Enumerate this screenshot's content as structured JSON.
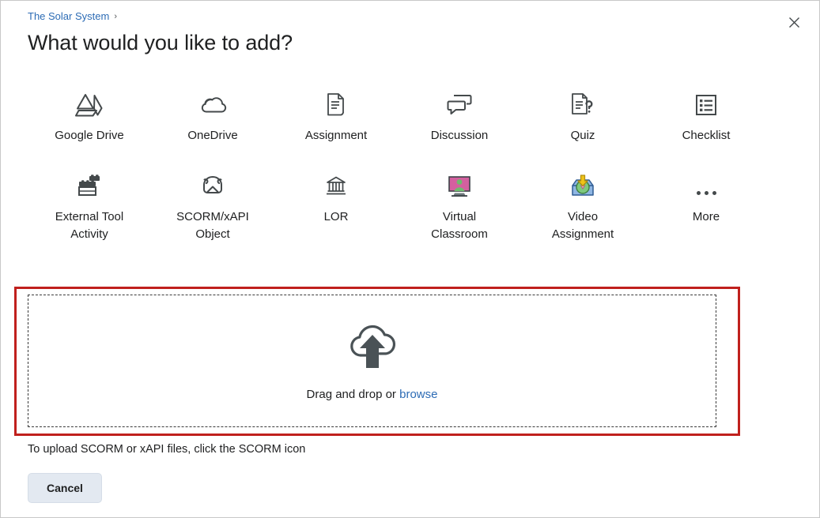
{
  "breadcrumb": {
    "label": "The Solar System",
    "separator": "›"
  },
  "header": {
    "title": "What would you like to add?",
    "close_label": "✕"
  },
  "grid": {
    "items": [
      {
        "label": "Google Drive",
        "icon": "google-drive-icon"
      },
      {
        "label": "OneDrive",
        "icon": "onedrive-cloud-icon"
      },
      {
        "label": "Assignment",
        "icon": "assignment-document-icon"
      },
      {
        "label": "Discussion",
        "icon": "discussion-bubbles-icon"
      },
      {
        "label": "Quiz",
        "icon": "quiz-question-document-icon"
      },
      {
        "label": "Checklist",
        "icon": "checklist-box-icon"
      },
      {
        "label": "External Tool Activity",
        "icon": "external-tool-blocks-icon"
      },
      {
        "label": "SCORM/xAPI Object",
        "icon": "scorm-xapi-icon"
      },
      {
        "label": "LOR",
        "icon": "lor-building-icon"
      },
      {
        "label": "Virtual Classroom",
        "icon": "virtual-classroom-monitor-icon"
      },
      {
        "label": "Video Assignment",
        "icon": "video-assignment-tray-icon"
      },
      {
        "label": "More",
        "icon": "more-ellipsis-icon"
      }
    ]
  },
  "dropzone": {
    "icon": "cloud-upload-icon",
    "text": "Drag and drop or",
    "link": "browse"
  },
  "hint": {
    "text": "To upload SCORM or xAPI files, click the SCORM icon"
  },
  "footer": {
    "cancel_label": "Cancel"
  },
  "colors": {
    "link": "#2d6cb5",
    "highlight_border": "#c0201d",
    "text": "#202122",
    "icon": "#44494b",
    "button_bg": "#e3e9f1",
    "virtual_classroom_screen": "#d4609f",
    "virtual_classroom_person": "#6cbd6c",
    "video_tray": "#7aa7dd",
    "video_arrow": "#f0c419"
  }
}
